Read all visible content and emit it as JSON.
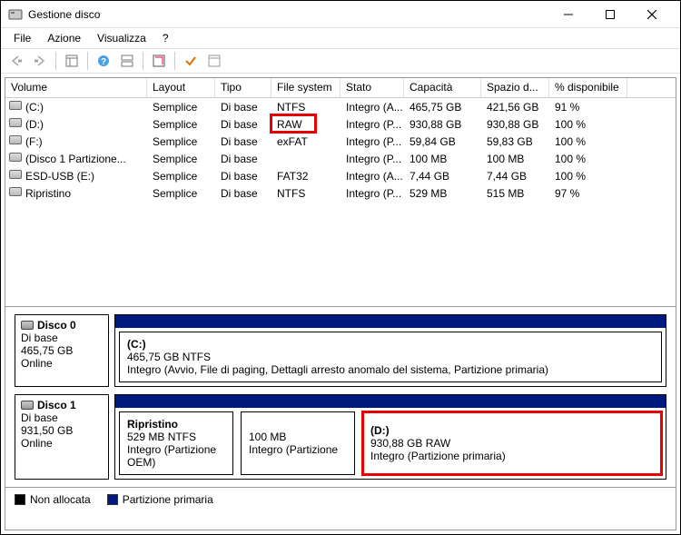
{
  "window": {
    "title": "Gestione disco"
  },
  "menu": {
    "file": "File",
    "action": "Azione",
    "view": "Visualizza",
    "help": "?"
  },
  "columns": {
    "volume": "Volume",
    "layout": "Layout",
    "type": "Tipo",
    "fs": "File system",
    "state": "Stato",
    "capacity": "Capacità",
    "free": "Spazio d...",
    "pct": "% disponibile"
  },
  "rows": [
    {
      "volume": "(C:)",
      "layout": "Semplice",
      "type": "Di base",
      "fs": "NTFS",
      "state": "Integro (A...",
      "capacity": "465,75 GB",
      "free": "421,56 GB",
      "pct": "91 %"
    },
    {
      "volume": "(D:)",
      "layout": "Semplice",
      "type": "Di base",
      "fs": "RAW",
      "state": "Integro (P...",
      "capacity": "930,88 GB",
      "free": "930,88 GB",
      "pct": "100 %"
    },
    {
      "volume": "(F:)",
      "layout": "Semplice",
      "type": "Di base",
      "fs": "exFAT",
      "state": "Integro (P...",
      "capacity": "59,84 GB",
      "free": "59,83 GB",
      "pct": "100 %"
    },
    {
      "volume": "(Disco 1 Partizione...",
      "layout": "Semplice",
      "type": "Di base",
      "fs": "",
      "state": "Integro (P...",
      "capacity": "100 MB",
      "free": "100 MB",
      "pct": "100 %"
    },
    {
      "volume": "ESD-USB (E:)",
      "layout": "Semplice",
      "type": "Di base",
      "fs": "FAT32",
      "state": "Integro (A...",
      "capacity": "7,44 GB",
      "free": "7,44 GB",
      "pct": "100 %"
    },
    {
      "volume": "Ripristino",
      "layout": "Semplice",
      "type": "Di base",
      "fs": "NTFS",
      "state": "Integro (P...",
      "capacity": "529 MB",
      "free": "515 MB",
      "pct": "97 %"
    }
  ],
  "disks": [
    {
      "name": "Disco 0",
      "type": "Di base",
      "size": "465,75 GB",
      "status": "Online",
      "partitions": [
        {
          "label": "(C:)",
          "line2": "465,75 GB NTFS",
          "line3": "Integro (Avvio, File di paging, Dettagli arresto anomalo del sistema, Partizione primaria)",
          "grow": 1
        }
      ]
    },
    {
      "name": "Disco 1",
      "type": "Di base",
      "size": "931,50 GB",
      "status": "Online",
      "partitions": [
        {
          "label": "Ripristino",
          "line2": "529 MB NTFS",
          "line3": "Integro (Partizione OEM)",
          "grow": 0,
          "w": 126
        },
        {
          "label": "",
          "line2": "100 MB",
          "line3": "Integro (Partizione",
          "grow": 0,
          "w": 126
        },
        {
          "label": "(D:)",
          "line2": "930,88 GB RAW",
          "line3": "Integro (Partizione primaria)",
          "grow": 1,
          "hl": true
        }
      ]
    }
  ],
  "legend": {
    "unallocated": "Non allocata",
    "primary": "Partizione primaria"
  }
}
